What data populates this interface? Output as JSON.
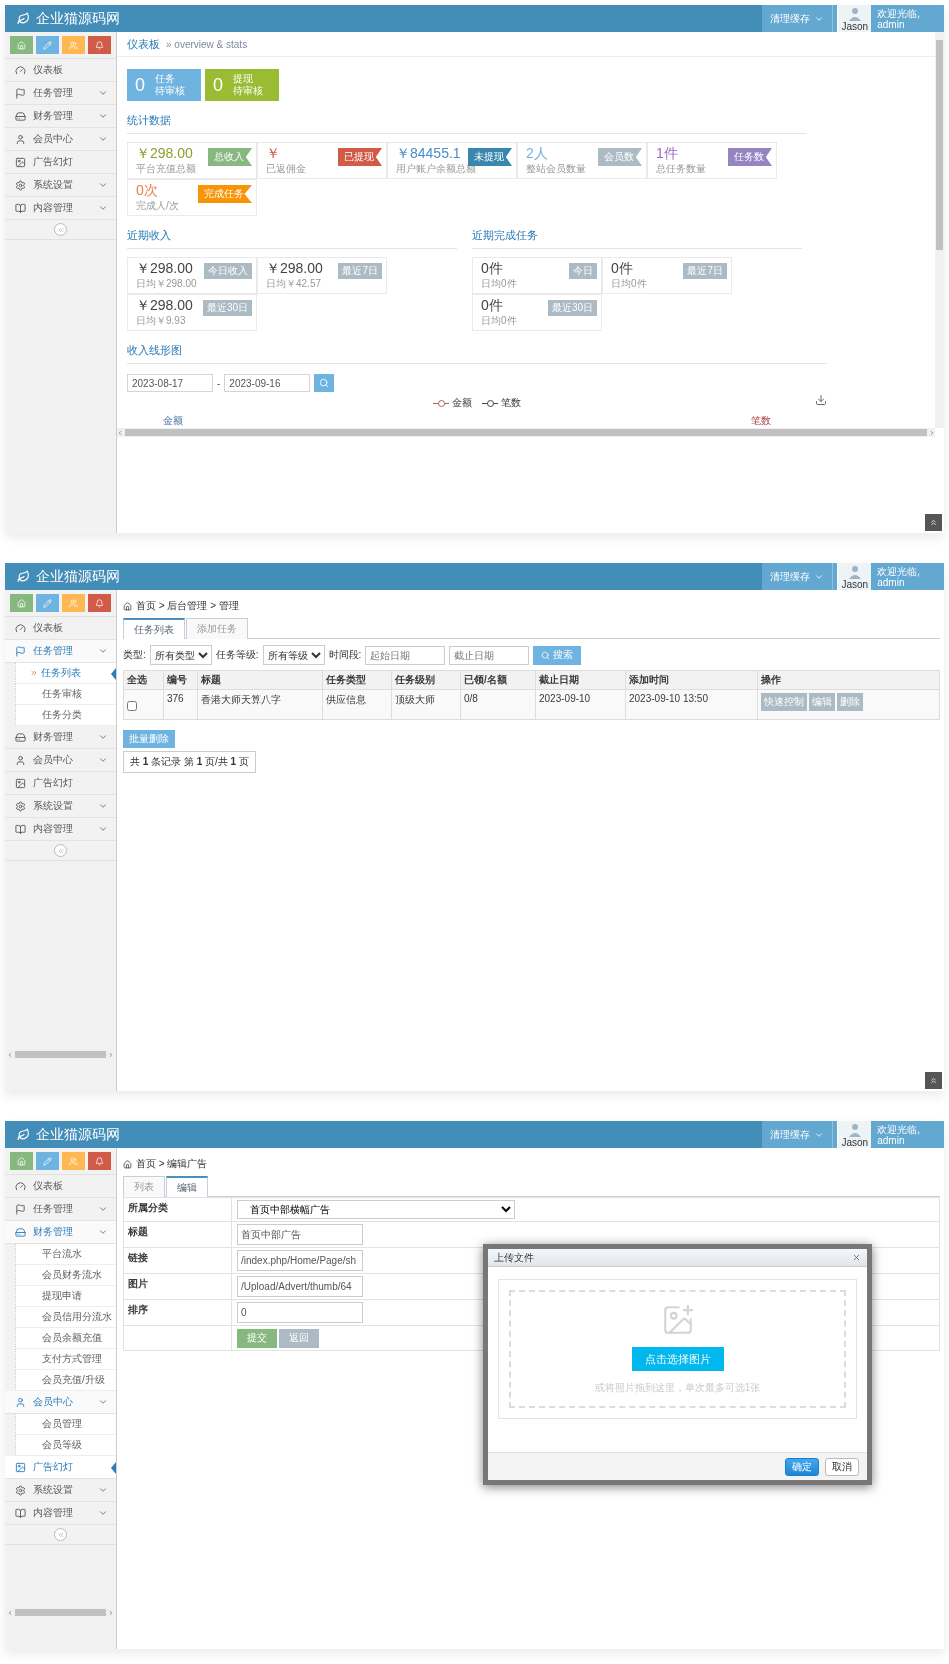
{
  "screens": [
    {
      "kind": "dashboard",
      "header": {
        "brand": "企业猫源码网",
        "cache_menu": "清理缓存",
        "avatar_caption": "Jason",
        "welcome": "欢迎光临,",
        "user": "admin"
      },
      "sidebar": {
        "shortcuts": [
          {
            "color": "#87b87f"
          },
          {
            "color": "#6fb3e0"
          },
          {
            "color": "#ffb752"
          },
          {
            "color": "#d15b47"
          }
        ],
        "scrollbar": false,
        "items": [
          {
            "kind": "link",
            "label": "仪表板",
            "selected": false
          },
          {
            "kind": "menu",
            "label": "任务管理",
            "expanded": false,
            "selected": false
          },
          {
            "kind": "menu",
            "label": "财务管理",
            "expanded": false,
            "selected": false
          },
          {
            "kind": "menu",
            "label": "会员中心",
            "expanded": false,
            "selected": false
          },
          {
            "kind": "link",
            "label": "广告幻灯",
            "selected": false
          },
          {
            "kind": "menu",
            "label": "系统设置",
            "expanded": false,
            "selected": false
          },
          {
            "kind": "menu",
            "label": "内容管理",
            "expanded": false,
            "selected": false
          }
        ]
      },
      "back_to_top": true,
      "breadcrumb": {
        "title": "仪表板",
        "subtitle": "» overview & stats"
      },
      "pending": [
        {
          "value": "0",
          "title": "任务",
          "subtitle": "待审核",
          "color": "#6fb3e0"
        },
        {
          "value": "0",
          "title": "提现",
          "subtitle": "待审核",
          "color": "#9abc32"
        }
      ],
      "stats": {
        "title": "统计数据",
        "cards": [
          {
            "value": "￥298.00",
            "caption": "平台充值总额",
            "color": "#8aa12c",
            "tag": {
              "label": "总收入",
              "color": "#87b87f"
            }
          },
          {
            "value": "￥",
            "caption": "已返佣金",
            "color": "#d15b47",
            "tag": {
              "label": "已提现",
              "color": "#d15b47"
            }
          },
          {
            "value": "￥84455.1",
            "caption": "用户账户余额总额",
            "color": "#478fca",
            "tag": {
              "label": "未提现",
              "color": "#3a87ad"
            }
          },
          {
            "value": "2人",
            "caption": "整站会员数量",
            "color": "#6fb3e0",
            "tag": {
              "label": "会员数",
              "color": "#abbac3"
            }
          },
          {
            "value": "1件",
            "caption": "总任务数量",
            "color": "#a069c3",
            "tag": {
              "label": "任务数",
              "color": "#9585bf"
            }
          },
          {
            "value": "0次",
            "caption": "完成人/次",
            "color": "#e8804a",
            "tag": {
              "label": "完成任务",
              "color": "#f89406"
            }
          }
        ]
      },
      "income": {
        "title": "近期收入",
        "cards": [
          {
            "value": "￥298.00",
            "caption": "日均￥298.00",
            "tag": "今日收入"
          },
          {
            "value": "￥298.00",
            "caption": "日均￥42.57",
            "tag": "最近7日"
          },
          {
            "value": "￥298.00",
            "caption": "日均￥9.93",
            "tag": "最近30日"
          }
        ]
      },
      "tasks": {
        "title": "近期完成任务",
        "cards": [
          {
            "value": "0件",
            "caption": "日均0件",
            "tag": "今日"
          },
          {
            "value": "0件",
            "caption": "日均0件",
            "tag": "最近7日"
          },
          {
            "value": "0件",
            "caption": "日均0件",
            "tag": "最近30日"
          }
        ]
      },
      "chart": {
        "title": "收入线形图",
        "date_from": "2023-08-17",
        "separator": "-",
        "date_to": "2023-09-16",
        "legend": [
          {
            "label": "金额",
            "color": "#b45f5f"
          },
          {
            "label": "笔数",
            "color": "#444444"
          }
        ],
        "left_axis": "金额",
        "right_axis": "笔数"
      }
    },
    {
      "kind": "task_list",
      "header": {
        "brand": "企业猫源码网",
        "cache_menu": "清理缓存",
        "avatar_caption": "Jason",
        "welcome": "欢迎光临,",
        "user": "admin"
      },
      "sidebar": {
        "shortcuts": [
          {
            "color": "#87b87f"
          },
          {
            "color": "#6fb3e0"
          },
          {
            "color": "#ffb752"
          },
          {
            "color": "#d15b47"
          }
        ],
        "scrollbar": true,
        "items": [
          {
            "kind": "link",
            "label": "仪表板",
            "selected": false
          },
          {
            "kind": "menu",
            "label": "任务管理",
            "expanded": true,
            "selected": false,
            "children": [
              {
                "label": "任务列表",
                "selected": true
              },
              {
                "label": "任务审核",
                "selected": false
              },
              {
                "label": "任务分类",
                "selected": false
              }
            ]
          },
          {
            "kind": "menu",
            "label": "财务管理",
            "expanded": false,
            "selected": false
          },
          {
            "kind": "menu",
            "label": "会员中心",
            "expanded": false,
            "selected": false
          },
          {
            "kind": "link",
            "label": "广告幻灯",
            "selected": false
          },
          {
            "kind": "menu",
            "label": "系统设置",
            "expanded": false,
            "selected": false
          },
          {
            "kind": "menu",
            "label": "内容管理",
            "expanded": false,
            "selected": false
          }
        ]
      },
      "back_to_top": true,
      "breadcrumb": "首页 > 后台管理 > 管理",
      "tabs": [
        {
          "label": "任务列表",
          "selected": true
        },
        {
          "label": "添加任务",
          "selected": false
        }
      ],
      "filters": {
        "type_label": "类型:",
        "type_value": "所有类型",
        "level_label": "任务等级:",
        "level_value": "所有等级",
        "period_label": "时间段:",
        "start_placeholder": "起始日期",
        "end_placeholder": "截止日期",
        "search": "搜索"
      },
      "table": {
        "columns": [
          "全选",
          "编号",
          "标题",
          "任务类型",
          "任务级别",
          "已领/名额",
          "截止日期",
          "添加时间",
          "操作"
        ],
        "rows": [
          {
            "cells": [
              {
                "kind": "checkbox",
                "checked": false
              },
              {
                "kind": "text",
                "text": "376"
              },
              {
                "kind": "text",
                "text": "香港大师天算八字"
              },
              {
                "kind": "text",
                "text": "供应信息"
              },
              {
                "kind": "text",
                "text": "顶级大师"
              },
              {
                "kind": "text",
                "text": "0/8"
              },
              {
                "kind": "text",
                "text": "2023-09-10"
              },
              {
                "kind": "text",
                "text": "2023-09-10 13:50"
              },
              {
                "kind": "actions",
                "buttons": [
                  "快速控制",
                  "编辑",
                  "删除"
                ]
              }
            ]
          }
        ]
      },
      "batch_delete": "批量删除",
      "pagination": "共 **1** 条记录 第 **1** 页/共 **1** 页"
    },
    {
      "kind": "ad_edit",
      "header": {
        "brand": "企业猫源码网",
        "cache_menu": "清理缓存",
        "avatar_caption": "Jason",
        "welcome": "欢迎光临,",
        "user": "admin"
      },
      "sidebar": {
        "shortcuts": [
          {
            "color": "#87b87f"
          },
          {
            "color": "#6fb3e0"
          },
          {
            "color": "#ffb752"
          },
          {
            "color": "#d15b47"
          }
        ],
        "scrollbar": true,
        "items": [
          {
            "kind": "link",
            "label": "仪表板",
            "selected": false
          },
          {
            "kind": "menu",
            "label": "任务管理",
            "expanded": false,
            "selected": false
          },
          {
            "kind": "menu",
            "label": "财务管理",
            "expanded": true,
            "selected": false,
            "children": [
              {
                "label": "平台流水",
                "selected": false
              },
              {
                "label": "会员财务流水",
                "selected": false
              },
              {
                "label": "提现申请",
                "selected": false
              },
              {
                "label": "会员信用分流水",
                "selected": false
              },
              {
                "label": "会员余额充值",
                "selected": false
              },
              {
                "label": "支付方式管理",
                "selected": false
              },
              {
                "label": "会员充值/升级",
                "selected": false
              }
            ]
          },
          {
            "kind": "menu",
            "label": "会员中心",
            "expanded": true,
            "selected": false,
            "children": [
              {
                "label": "会员管理",
                "selected": false
              },
              {
                "label": "会员等级",
                "selected": false
              }
            ]
          },
          {
            "kind": "link",
            "label": "广告幻灯",
            "selected": true
          },
          {
            "kind": "menu",
            "label": "系统设置",
            "expanded": false,
            "selected": false
          },
          {
            "kind": "menu",
            "label": "内容管理",
            "expanded": false,
            "selected": false
          }
        ]
      },
      "back_to_top": false,
      "breadcrumb": "首页 > 编辑广告",
      "tabs": [
        {
          "label": "列表",
          "selected": false
        },
        {
          "label": "编辑",
          "selected": true
        }
      ],
      "form": [
        {
          "label": "所属分类",
          "kind": "select",
          "value": "首页中部横幅广告"
        },
        {
          "label": "标题",
          "kind": "input",
          "value": "首页中部广告"
        },
        {
          "label": "链接",
          "kind": "input",
          "value": "/index.php/Home/Page/sh"
        },
        {
          "label": "图片",
          "kind": "input",
          "value": "/Upload/Advert/thumb/64"
        },
        {
          "label": "排序",
          "kind": "input",
          "value": "0"
        }
      ],
      "form_buttons": [
        {
          "label": "提交",
          "color": "#87b87f"
        },
        {
          "label": "返回",
          "color": "#abbac3"
        }
      ],
      "dialog": {
        "title": "上传文件",
        "pick_button": "点击选择图片",
        "hint": "或将照片拖到这里，单次最多可选1张",
        "buttons": [
          {
            "label": "确定",
            "kind": "primary"
          },
          {
            "label": "取消",
            "kind": "default"
          }
        ]
      }
    }
  ]
}
